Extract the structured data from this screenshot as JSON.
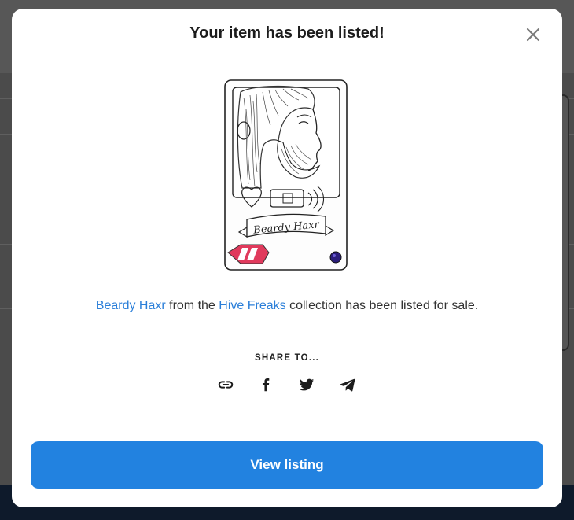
{
  "modal": {
    "title": "Your item has been listed!",
    "description": {
      "item_name": "Beardy Haxr",
      "text_1": " from the ",
      "collection_name": "Hive Freaks",
      "text_2": " collection has been listed for sale."
    },
    "card": {
      "banner_text": "Beardy Haxr",
      "image_subject": "sketched bearded man card"
    },
    "share_label": "SHARE TO...",
    "share_icons": [
      "link-icon",
      "facebook-icon",
      "twitter-icon",
      "telegram-icon"
    ],
    "button_label": "View listing"
  },
  "colors": {
    "accent": "#2282e0",
    "link": "#2b7fd9",
    "title_text": "#1c1c1c",
    "overlay": "#4b4b4b"
  }
}
